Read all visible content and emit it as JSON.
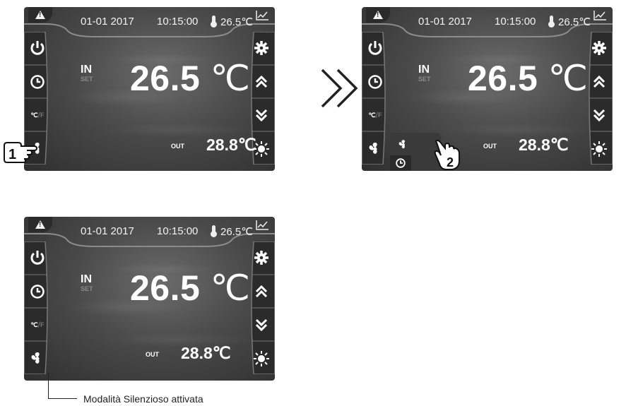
{
  "status": {
    "date": "01-01 2017",
    "time": "10:15:00",
    "ambient_temp": "26.5℃"
  },
  "main": {
    "in_label": "IN",
    "set_label": "SET",
    "in_temp_value": "26.5",
    "in_temp_unit": "℃",
    "out_label": "OUT",
    "out_temp": "28.8℃"
  },
  "left_buttons": [
    "power-icon",
    "clock-icon",
    "unit-toggle-icon",
    "fan-icon"
  ],
  "right_buttons": [
    "settings-gear-icon",
    "up-arrow-icon",
    "down-arrow-icon",
    "sun-icon"
  ],
  "unit_toggle": {
    "c": "℃",
    "f": "F"
  },
  "steps": {
    "step1": "1",
    "step2": "2"
  },
  "caption": "Modalità Silenzioso attivata",
  "colors": {
    "screen": "#4a4a4a",
    "text": "#ffffff",
    "panel": "#2b2b2b"
  }
}
